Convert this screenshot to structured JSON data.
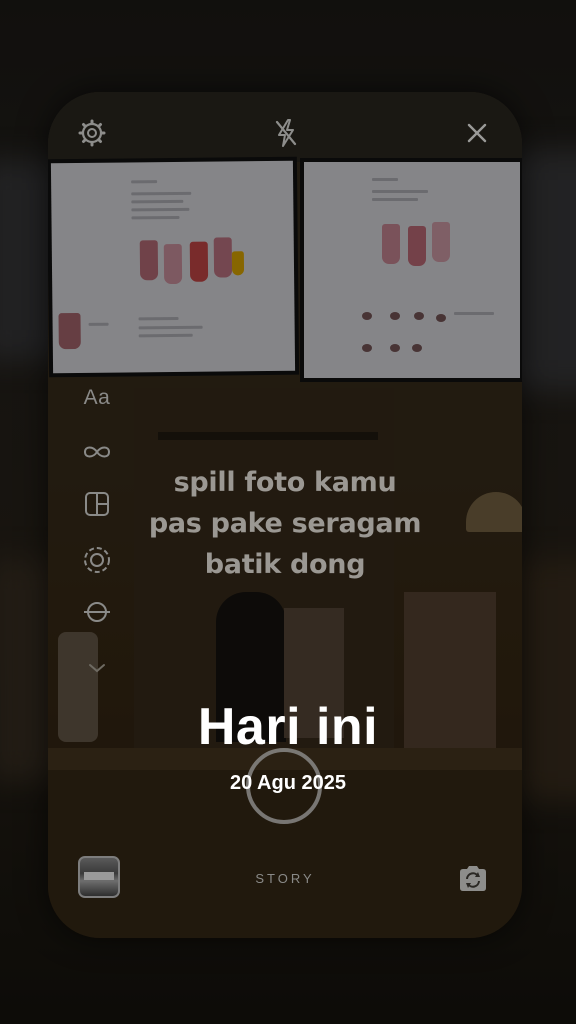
{
  "sticker": {
    "lines": [
      "spill foto kamu",
      "pas pake seragam",
      "batik dong"
    ]
  },
  "tools": {
    "text_label": "Aa"
  },
  "date_overlay": {
    "title": "Hari ini",
    "subtitle": "20 Agu 2025"
  },
  "camera": {
    "mode_label": "STORY"
  },
  "icons": {
    "settings": "gear-icon",
    "flash": "flash-off-icon",
    "close": "close-icon",
    "boomerang": "infinity-icon",
    "layout": "layout-grid-icon",
    "multi_capture": "dashed-circle-icon",
    "level": "level-icon",
    "more": "chevron-down-icon",
    "flip": "flip-camera-icon"
  },
  "colors": {
    "overlay_text": "#ffffff",
    "muted_ui": "#8a8a88",
    "backdrop": "#131210"
  }
}
